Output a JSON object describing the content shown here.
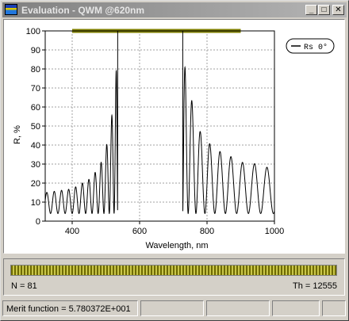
{
  "window": {
    "title": "Evaluation - QWM @620nm",
    "icon": "app-chart-icon",
    "buttons": [
      {
        "name": "minimize",
        "glyph": "_"
      },
      {
        "name": "maximize",
        "glyph": "□"
      },
      {
        "name": "close",
        "glyph": "✕"
      }
    ]
  },
  "chart_data": {
    "type": "line",
    "title": "",
    "xlabel": "Wavelength, nm",
    "ylabel": "R, %",
    "xlim": [
      320,
      1000
    ],
    "ylim": [
      0,
      100
    ],
    "x_ticks": [
      400,
      600,
      800,
      1000
    ],
    "y_ticks": [
      0,
      10,
      20,
      30,
      40,
      50,
      60,
      70,
      80,
      90,
      100
    ],
    "grid": true,
    "legend": {
      "position": "top-right",
      "entries": [
        "Rs  0°"
      ]
    },
    "target": {
      "x_range": [
        400,
        900
      ],
      "value": 100,
      "color": "#808000"
    },
    "series": [
      {
        "name": "Rs  0°",
        "color": "#000000",
        "stopband": [
          535,
          728
        ],
        "approx_minimum": 4,
        "envelope_max": [
          [
            320,
            15
          ],
          [
            400,
            17
          ],
          [
            450,
            22
          ],
          [
            480,
            28
          ],
          [
            500,
            38
          ],
          [
            515,
            52
          ],
          [
            525,
            66
          ],
          [
            533,
            85
          ],
          [
            540,
            100
          ],
          [
            725,
            100
          ],
          [
            730,
            85
          ],
          [
            740,
            76
          ],
          [
            760,
            59
          ],
          [
            780,
            47
          ],
          [
            820,
            38
          ],
          [
            860,
            35
          ],
          [
            900,
            31
          ],
          [
            950,
            30
          ],
          [
            1000,
            27
          ]
        ]
      }
    ]
  },
  "panel": {
    "progress_fraction": 1.0,
    "n_label": "N = 81",
    "th_label": "Th = 12555"
  },
  "status": {
    "merit": "Merit function =  5.780372E+001",
    "cells": [
      "",
      "",
      "",
      ""
    ]
  }
}
